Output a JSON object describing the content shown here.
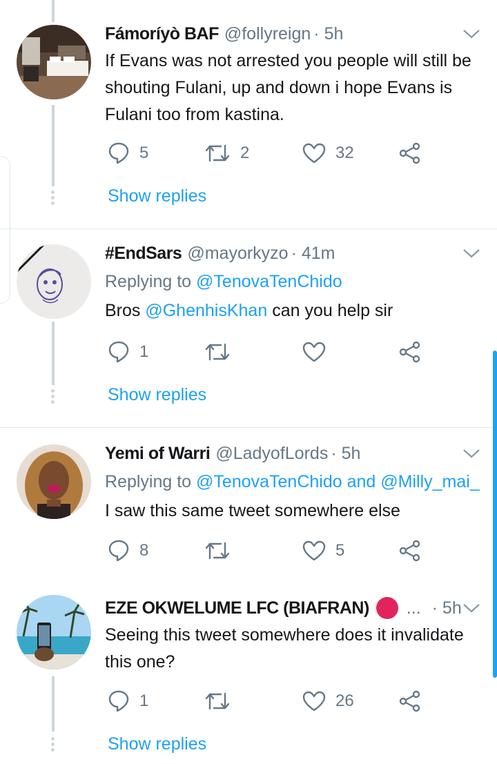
{
  "colors": {
    "accent": "#1da1f2",
    "muted": "#657786",
    "text": "#14171a",
    "line": "#ccd6dd",
    "red_dot": "#e0245e"
  },
  "tweets": [
    {
      "name": "Fámoríyò BAF",
      "handle": "@follyreign",
      "time": "· 5h",
      "text_lines": [
        "If Evans was not arrested you people will still be",
        "shouting Fulani, up and down i hope  Evans is",
        "Fulani too from kastina."
      ],
      "replies": "5",
      "retweets": "2",
      "likes": "32",
      "show_replies": "Show replies",
      "avatar": "hotel-room-avatar"
    },
    {
      "name": "#EndSars",
      "handle": "@mayorkyzo",
      "time": "· 41m",
      "replying_prefix": "Replying to",
      "replying_to": "@TenovaTenChido",
      "text_before": "Bros ",
      "mention": "@GhenhisKhan",
      "text_after": " can you help sir",
      "replies": "1",
      "retweets": "",
      "likes": "",
      "show_replies": "Show replies",
      "avatar": "sketch-face-avatar"
    },
    {
      "name": "Yemi of Warri",
      "handle": "@LadyofLords",
      "time": "· 5h",
      "replying_prefix": "Replying to",
      "replying_to": "@TenovaTenChido",
      "replying_and": " and ",
      "replying_to2": "@Milly_mai_",
      "text": "I saw this same tweet somewhere else",
      "replies": "8",
      "retweets": "",
      "likes": "5",
      "avatar": "woman-portrait-avatar"
    },
    {
      "name": "EZE OKWELUME LFC (BIAFRAN)",
      "ellipsis": "...",
      "time": "· 5h",
      "text_lines": [
        "Seeing this tweet somewhere does it invalidate",
        "this one?"
      ],
      "replies": "1",
      "retweets": "",
      "likes": "26",
      "show_replies": "Show replies",
      "avatar": "beach-pool-avatar"
    }
  ]
}
